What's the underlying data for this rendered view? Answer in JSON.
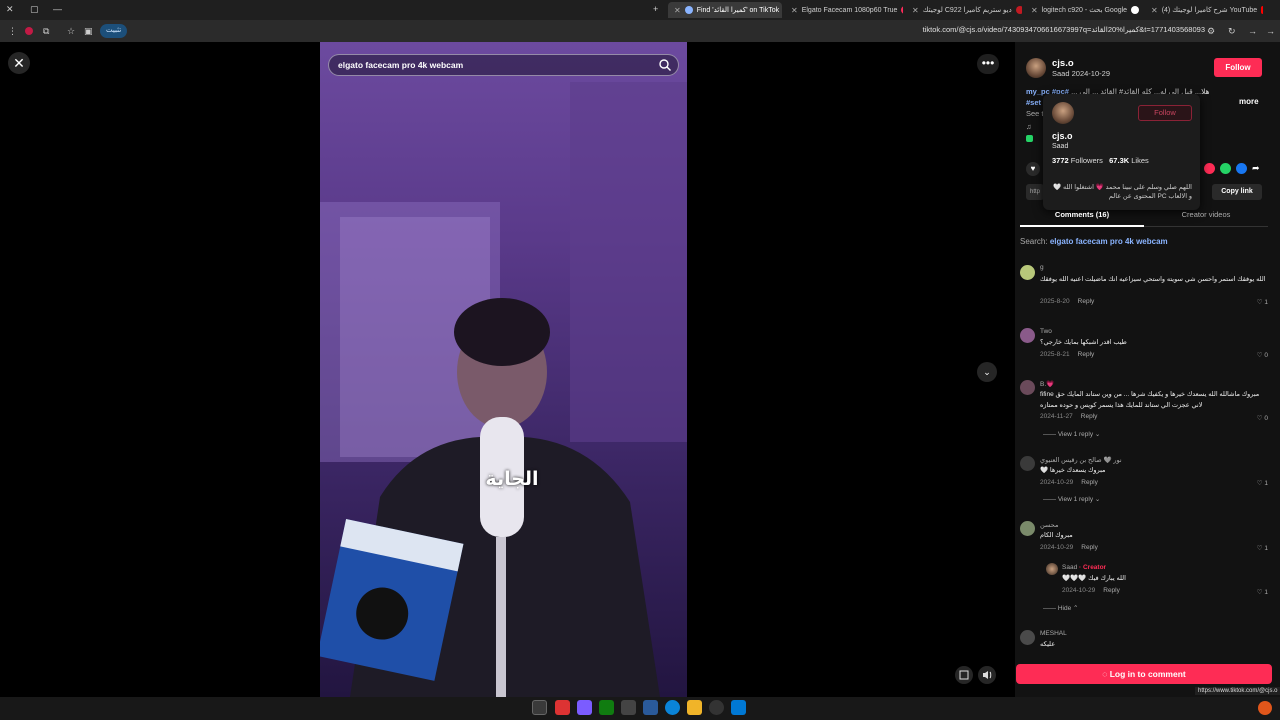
{
  "browser": {
    "tabs": [
      {
        "title": "(4) شرح كاميرا لوجيتك YouTube"
      },
      {
        "title": "logitech c920 - بحث Google"
      },
      {
        "title": "لوجيتك C922 ديو ستريم كاميرا"
      },
      {
        "title": "Elgato Facecam 1080p60 True"
      },
      {
        "title": "Find 'كميرا القائد' on TikTok"
      }
    ],
    "url": "tiktok.com/@cjs.o/video/7430934706616673997q=كميرا%20القائد&t=1771403568093",
    "install_label": "تثبيت"
  },
  "player": {
    "close_icon": "close-icon",
    "search_query": "elgato facecam pro 4k webcam",
    "caption": "الجاية"
  },
  "author": {
    "username": "cjs.o",
    "nickname": "Saad",
    "date": "2024-10-29",
    "follow_label": "Follow",
    "description_tags": [
      "#my_pc",
      "#pc",
      "#set"
    ],
    "description_text": "هلا... قبل الي له... كله القائد# القائد ... الي ...",
    "see_label": "See t",
    "more_label": "more"
  },
  "hovercard": {
    "username": "cjs.o",
    "nickname": "Saad",
    "follow_label": "Follow",
    "followers": "3772",
    "followers_label": "Followers",
    "likes": "67.3K",
    "likes_label": "Likes",
    "bio": "اللهم صلي وسلم على نبينا محمد 💗 اشتغلوا الله 🤍 و الالعاب PC المحتوى عن عالم"
  },
  "actions": {
    "link_stub": "http",
    "copy_link_label": "Copy link"
  },
  "tabs": {
    "comments_label": "Comments (16)",
    "creator_label": "Creator videos"
  },
  "search_line": {
    "prefix": "Search:",
    "query": "elgato facecam pro 4k webcam"
  },
  "comments": [
    {
      "user": "g",
      "text": "الله يوفقك استمر واحسن شي سويته واستحي سيزاعيه انك ماضيلت اعنيه الله يوفقك",
      "date": "2025-8-20",
      "reply": "Reply",
      "likes": "1"
    },
    {
      "user": "Two",
      "text": "طيب اقدر اشبكها بمايك خارجي؟",
      "date": "2025-8-21",
      "reply": "Reply",
      "likes": "0"
    },
    {
      "user": "B.💗",
      "text": "مبروك ماشالله الله يسعدك خيرها و يكفيك شرها ... من وين ستاند المايك حق fifine",
      "text2": "لاني عجزت الي ستاند للمايك هذا يسمر كويس و حوده ممتازه",
      "date": "2024-11-27",
      "reply": "Reply",
      "likes": "0",
      "view_replies": "View 1 reply"
    },
    {
      "user": "نور 🩶 صالح بن رقيس العنيوي",
      "text": "مبروك يسعدك خيرها 🤍",
      "date": "2024-10-29",
      "reply": "Reply",
      "likes": "1",
      "view_replies": "View 1 reply"
    },
    {
      "user": "محسن",
      "text": "مبروك الكام",
      "date": "2024-10-29",
      "reply": "Reply",
      "likes": "1"
    },
    {
      "user": "Saad",
      "creator_tag": "· Creator",
      "text": "الله يبارك فيك 🤍🤍🤍",
      "date": "2024-10-29",
      "reply": "Reply",
      "likes": "1",
      "hide": "Hide"
    },
    {
      "user": "MESHAL",
      "text": "عليكه"
    }
  ],
  "login_label": "Log in to comment",
  "status_url": "https://www.tiktok.com/@cjs.o",
  "colors": {
    "accent": "#fe2c55",
    "panel": "#121212",
    "link": "#8ab4ff"
  }
}
